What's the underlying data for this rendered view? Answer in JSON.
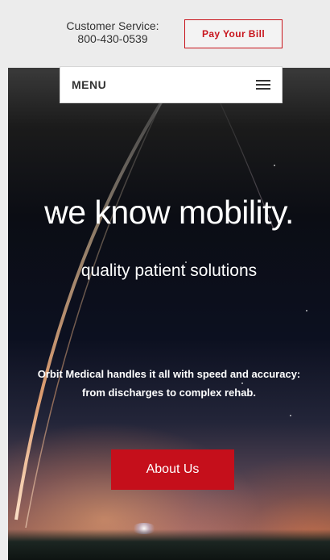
{
  "header": {
    "customer_service_label": "Customer Service:",
    "customer_service_phone": "800-430-0539",
    "pay_bill_label": "Pay Your Bill"
  },
  "nav": {
    "menu_label": "MENU",
    "menu_icon": "hamburger-icon"
  },
  "hero": {
    "headline": "we know mobility.",
    "subheadline": "quality patient solutions",
    "description_line1": "Orbit Medical handles it all with speed and accuracy:",
    "description_line2": "from discharges to complex rehab.",
    "cta_label": "About Us"
  },
  "colors": {
    "accent": "#c50f1b",
    "topbar_bg": "#ececec",
    "text_dark": "#333333"
  }
}
